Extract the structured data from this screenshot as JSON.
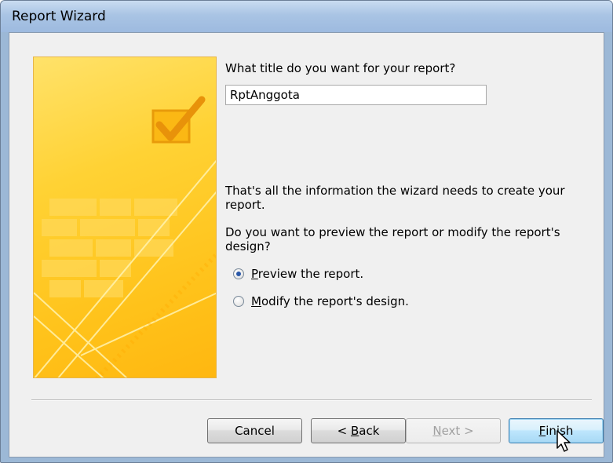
{
  "window": {
    "title": "Report Wizard"
  },
  "question": "What title do you want for your report?",
  "title_field": {
    "value": "RptAnggota"
  },
  "info_text": "That's all the information the wizard needs to create your report.",
  "preview_question": "Do you want to preview the report or modify the report's design?",
  "options": [
    {
      "mnemonic": "P",
      "rest": "review the report.",
      "selected": true
    },
    {
      "mnemonic": "M",
      "rest": "odify the report's design.",
      "selected": false
    }
  ],
  "buttons": {
    "cancel": "Cancel",
    "back_prefix": "< ",
    "back_mnemonic": "B",
    "back_rest": "ack",
    "next_mnemonic": "N",
    "next_rest": "ext >",
    "finish_mnemonic": "F",
    "finish_rest": "inish"
  },
  "colors": {
    "accent": "#ffc21a",
    "titlebar": "#a9c4e4",
    "radio_dot": "#2a58a8"
  },
  "icons": {
    "art": "checkbox-check-icon",
    "cursor": "mouse-pointer-icon"
  }
}
